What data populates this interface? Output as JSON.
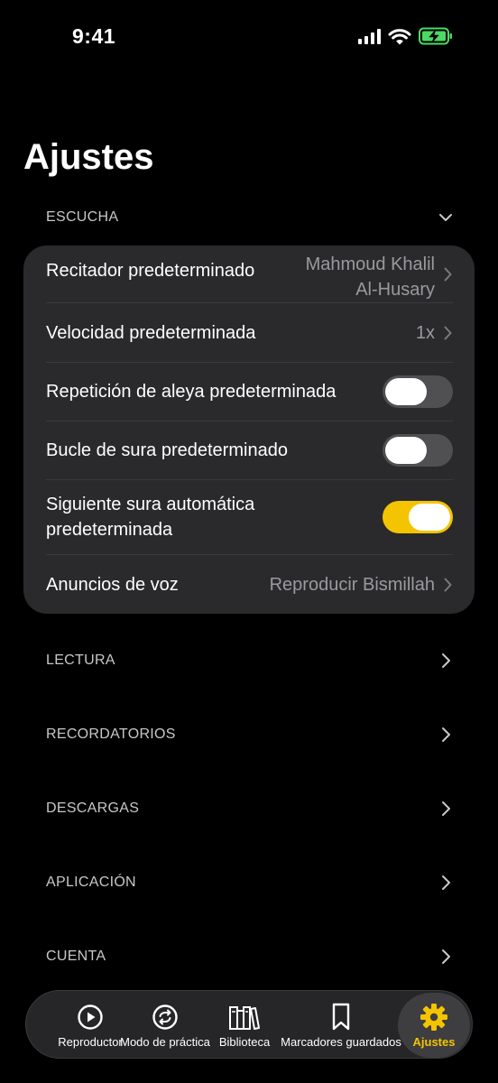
{
  "status_bar": {
    "time": "9:41"
  },
  "page": {
    "title": "Ajustes"
  },
  "sections": {
    "listening": {
      "label": "ESCUCHA",
      "rows": {
        "reciter": {
          "label": "Recitador predeterminado",
          "value_line1": "Mahmoud Khalil",
          "value_line2": "Al-Husary"
        },
        "speed": {
          "label": "Velocidad predeterminada",
          "value": "1x"
        },
        "verse_repeat": {
          "label": "Repetición de aleya predeterminada",
          "enabled": false
        },
        "surah_loop": {
          "label": "Bucle de sura predeterminado",
          "enabled": false
        },
        "auto_next": {
          "label_line1": "Siguiente sura automática",
          "label_line2": "predeterminada",
          "enabled": true
        },
        "voice": {
          "label": "Anuncios de voz",
          "value": "Reproducir Bismillah"
        }
      }
    },
    "reading": {
      "label": "LECTURA"
    },
    "reminders": {
      "label": "RECORDATORIOS"
    },
    "downloads": {
      "label": "DESCARGAS"
    },
    "app": {
      "label": "APLICACIÓN"
    },
    "account": {
      "label": "CUENTA"
    }
  },
  "tab_bar": {
    "tabs": [
      {
        "label": "Reproductor",
        "icon": "play-circle-icon"
      },
      {
        "label": "Modo de práctica",
        "icon": "repeat-circle-icon"
      },
      {
        "label": "Biblioteca",
        "icon": "books-icon"
      },
      {
        "label": "Marcadores guardados",
        "icon": "bookmark-icon"
      },
      {
        "label": "Ajustes",
        "icon": "gear-icon",
        "active": true
      }
    ]
  },
  "colors": {
    "accent": "#f5c400",
    "card": "#2a2a2c",
    "background": "#000000"
  }
}
